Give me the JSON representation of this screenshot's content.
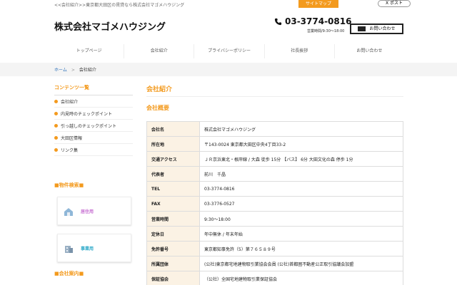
{
  "topbar": {
    "tagline": "<<会社紹介>>東京都大田区の賃貸なら株式会社マゴメハウジング",
    "sitemap_label": "サイトマップ",
    "post_label": "X ポスト"
  },
  "header": {
    "logo": "株式会社マゴメハウジング",
    "phone": "03-3774-0816",
    "hours": "営業時間/9:30〜18:00",
    "contact_label": "お問い合わせ"
  },
  "nav": {
    "items": [
      "トップページ",
      "会社紹介",
      "プライバシーポリシー",
      "社長挨拶",
      "お問い合わせ"
    ]
  },
  "breadcrumb": {
    "home": "ホーム",
    "sep": ">",
    "current": "会社紹介"
  },
  "sidebar": {
    "contents_title": "コンテンツ一覧",
    "items": [
      "会社紹介",
      "内見時のチェックポイント",
      "引っ越しのチェックポイント",
      "大田区情報",
      "リンク集"
    ],
    "search_title": "■物件検索■",
    "banner_residential": "居住用",
    "banner_business": "事業用",
    "company_title": "■会社案内■"
  },
  "main": {
    "page_title": "会社紹介",
    "section_title": "会社概要",
    "rows": [
      {
        "label": "会社名",
        "value": "株式会社マゴメハウジング"
      },
      {
        "label": "所在地",
        "value": "〒143-0024 東京都大田区中央4丁目33-2"
      },
      {
        "label": "交通アクセス",
        "value": "ＪＲ京浜東北・根岸線 / 大森 徒歩 15分 【バス】 6分 大田文化の森 停歩 1分"
      },
      {
        "label": "代表者",
        "value": "前川　千晶"
      },
      {
        "label": "TEL",
        "value": "03-3774-0816"
      },
      {
        "label": "FAX",
        "value": "03-3776-0527"
      },
      {
        "label": "営業時間",
        "value": "9:30〜18:00"
      },
      {
        "label": "定休日",
        "value": "年中無休 / 年末年始"
      },
      {
        "label": "免許番号",
        "value": "東京都知事免許（5）第７６５８９号"
      },
      {
        "label": "所属団体",
        "value": "(公社)東京都宅地建物取引業協会会員 (公社)首都圏不動産公正取引協議会加盟"
      },
      {
        "label": "保証協会",
        "value": "（公社）全国宅地建物取引業保証協会"
      }
    ]
  },
  "colors": {
    "accent": "#f39a1e",
    "link": "#2a6eb8",
    "table_header_bg": "#fbf2e4"
  }
}
